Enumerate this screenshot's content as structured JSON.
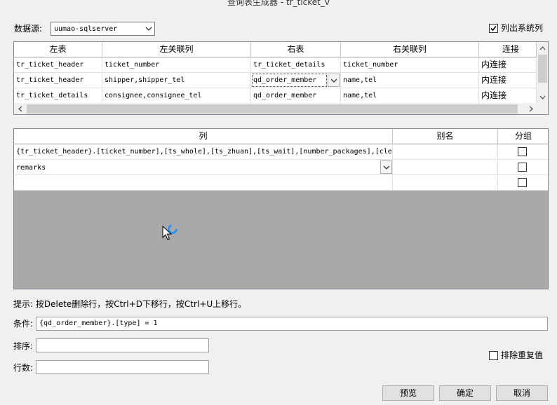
{
  "window": {
    "title": "查询表生成器 - tr_ticket_v"
  },
  "datasource": {
    "label": "数据源:",
    "value": "uumao-sqlserver"
  },
  "show_system_columns": {
    "label": "列出系统列",
    "checked": true
  },
  "join_grid": {
    "headers": [
      "左表",
      "左关联列",
      "右表",
      "右关联列",
      "连接"
    ],
    "rows": [
      {
        "left": "tr_ticket_header",
        "left_cols": "ticket_number",
        "right": "tr_ticket_details",
        "right_cols": "ticket_number",
        "join": "内连接"
      },
      {
        "left": "tr_ticket_header",
        "left_cols": "shipper,shipper_tel",
        "right": "qd_order_member",
        "right_cols": "name,tel",
        "join": "内连接"
      },
      {
        "left": "tr_ticket_details",
        "left_cols": "consignee,consignee_tel",
        "right": "qd_order_member",
        "right_cols": "name,tel",
        "join": "内连接"
      }
    ]
  },
  "column_grid": {
    "headers": [
      "列",
      "别名",
      "分组"
    ],
    "rows": [
      {
        "column": "{tr_ticket_header}.[ticket_number],[ts_whole],[ts_zhuan],[ts_wait],[number_packages],[cle",
        "alias": "",
        "group": false
      },
      {
        "column": "remarks",
        "alias": "",
        "group": false
      },
      {
        "column": "",
        "alias": "",
        "group": false
      }
    ]
  },
  "hint": "提示: 按Delete删除行，按Ctrl+D下移行，按Ctrl+U上移行。",
  "condition": {
    "label": "条件:",
    "value": "{qd_order_member}.[type] = 1"
  },
  "sort": {
    "label": "排序:",
    "value": ""
  },
  "rows_count": {
    "label": "行数:",
    "value": ""
  },
  "distinct": {
    "label": "排除重复值",
    "checked": false
  },
  "buttons": {
    "preview": "预览",
    "ok": "确定",
    "cancel": "取消"
  },
  "icons": {
    "cursor": "busy-cursor-icon",
    "dropdown": "chevron-down-icon",
    "check": "checkmark-icon"
  }
}
